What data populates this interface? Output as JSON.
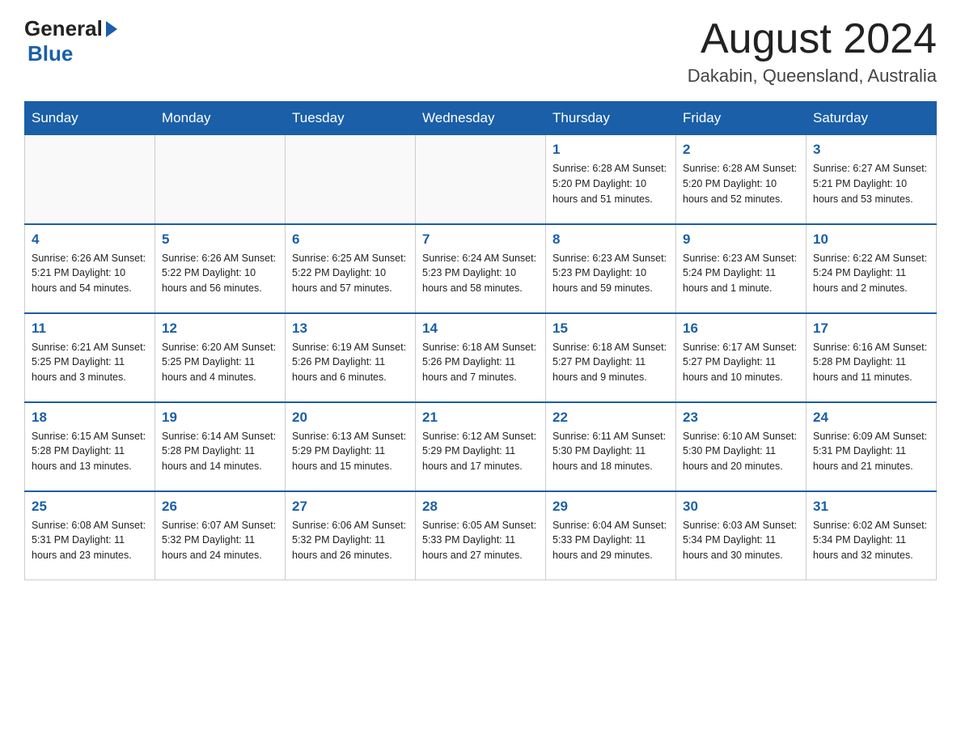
{
  "logo": {
    "general": "General",
    "blue": "Blue"
  },
  "header": {
    "month": "August 2024",
    "location": "Dakabin, Queensland, Australia"
  },
  "weekdays": [
    "Sunday",
    "Monday",
    "Tuesday",
    "Wednesday",
    "Thursday",
    "Friday",
    "Saturday"
  ],
  "weeks": [
    [
      {
        "day": "",
        "info": ""
      },
      {
        "day": "",
        "info": ""
      },
      {
        "day": "",
        "info": ""
      },
      {
        "day": "",
        "info": ""
      },
      {
        "day": "1",
        "info": "Sunrise: 6:28 AM\nSunset: 5:20 PM\nDaylight: 10 hours and 51 minutes."
      },
      {
        "day": "2",
        "info": "Sunrise: 6:28 AM\nSunset: 5:20 PM\nDaylight: 10 hours and 52 minutes."
      },
      {
        "day": "3",
        "info": "Sunrise: 6:27 AM\nSunset: 5:21 PM\nDaylight: 10 hours and 53 minutes."
      }
    ],
    [
      {
        "day": "4",
        "info": "Sunrise: 6:26 AM\nSunset: 5:21 PM\nDaylight: 10 hours and 54 minutes."
      },
      {
        "day": "5",
        "info": "Sunrise: 6:26 AM\nSunset: 5:22 PM\nDaylight: 10 hours and 56 minutes."
      },
      {
        "day": "6",
        "info": "Sunrise: 6:25 AM\nSunset: 5:22 PM\nDaylight: 10 hours and 57 minutes."
      },
      {
        "day": "7",
        "info": "Sunrise: 6:24 AM\nSunset: 5:23 PM\nDaylight: 10 hours and 58 minutes."
      },
      {
        "day": "8",
        "info": "Sunrise: 6:23 AM\nSunset: 5:23 PM\nDaylight: 10 hours and 59 minutes."
      },
      {
        "day": "9",
        "info": "Sunrise: 6:23 AM\nSunset: 5:24 PM\nDaylight: 11 hours and 1 minute."
      },
      {
        "day": "10",
        "info": "Sunrise: 6:22 AM\nSunset: 5:24 PM\nDaylight: 11 hours and 2 minutes."
      }
    ],
    [
      {
        "day": "11",
        "info": "Sunrise: 6:21 AM\nSunset: 5:25 PM\nDaylight: 11 hours and 3 minutes."
      },
      {
        "day": "12",
        "info": "Sunrise: 6:20 AM\nSunset: 5:25 PM\nDaylight: 11 hours and 4 minutes."
      },
      {
        "day": "13",
        "info": "Sunrise: 6:19 AM\nSunset: 5:26 PM\nDaylight: 11 hours and 6 minutes."
      },
      {
        "day": "14",
        "info": "Sunrise: 6:18 AM\nSunset: 5:26 PM\nDaylight: 11 hours and 7 minutes."
      },
      {
        "day": "15",
        "info": "Sunrise: 6:18 AM\nSunset: 5:27 PM\nDaylight: 11 hours and 9 minutes."
      },
      {
        "day": "16",
        "info": "Sunrise: 6:17 AM\nSunset: 5:27 PM\nDaylight: 11 hours and 10 minutes."
      },
      {
        "day": "17",
        "info": "Sunrise: 6:16 AM\nSunset: 5:28 PM\nDaylight: 11 hours and 11 minutes."
      }
    ],
    [
      {
        "day": "18",
        "info": "Sunrise: 6:15 AM\nSunset: 5:28 PM\nDaylight: 11 hours and 13 minutes."
      },
      {
        "day": "19",
        "info": "Sunrise: 6:14 AM\nSunset: 5:28 PM\nDaylight: 11 hours and 14 minutes."
      },
      {
        "day": "20",
        "info": "Sunrise: 6:13 AM\nSunset: 5:29 PM\nDaylight: 11 hours and 15 minutes."
      },
      {
        "day": "21",
        "info": "Sunrise: 6:12 AM\nSunset: 5:29 PM\nDaylight: 11 hours and 17 minutes."
      },
      {
        "day": "22",
        "info": "Sunrise: 6:11 AM\nSunset: 5:30 PM\nDaylight: 11 hours and 18 minutes."
      },
      {
        "day": "23",
        "info": "Sunrise: 6:10 AM\nSunset: 5:30 PM\nDaylight: 11 hours and 20 minutes."
      },
      {
        "day": "24",
        "info": "Sunrise: 6:09 AM\nSunset: 5:31 PM\nDaylight: 11 hours and 21 minutes."
      }
    ],
    [
      {
        "day": "25",
        "info": "Sunrise: 6:08 AM\nSunset: 5:31 PM\nDaylight: 11 hours and 23 minutes."
      },
      {
        "day": "26",
        "info": "Sunrise: 6:07 AM\nSunset: 5:32 PM\nDaylight: 11 hours and 24 minutes."
      },
      {
        "day": "27",
        "info": "Sunrise: 6:06 AM\nSunset: 5:32 PM\nDaylight: 11 hours and 26 minutes."
      },
      {
        "day": "28",
        "info": "Sunrise: 6:05 AM\nSunset: 5:33 PM\nDaylight: 11 hours and 27 minutes."
      },
      {
        "day": "29",
        "info": "Sunrise: 6:04 AM\nSunset: 5:33 PM\nDaylight: 11 hours and 29 minutes."
      },
      {
        "day": "30",
        "info": "Sunrise: 6:03 AM\nSunset: 5:34 PM\nDaylight: 11 hours and 30 minutes."
      },
      {
        "day": "31",
        "info": "Sunrise: 6:02 AM\nSunset: 5:34 PM\nDaylight: 11 hours and 32 minutes."
      }
    ]
  ]
}
